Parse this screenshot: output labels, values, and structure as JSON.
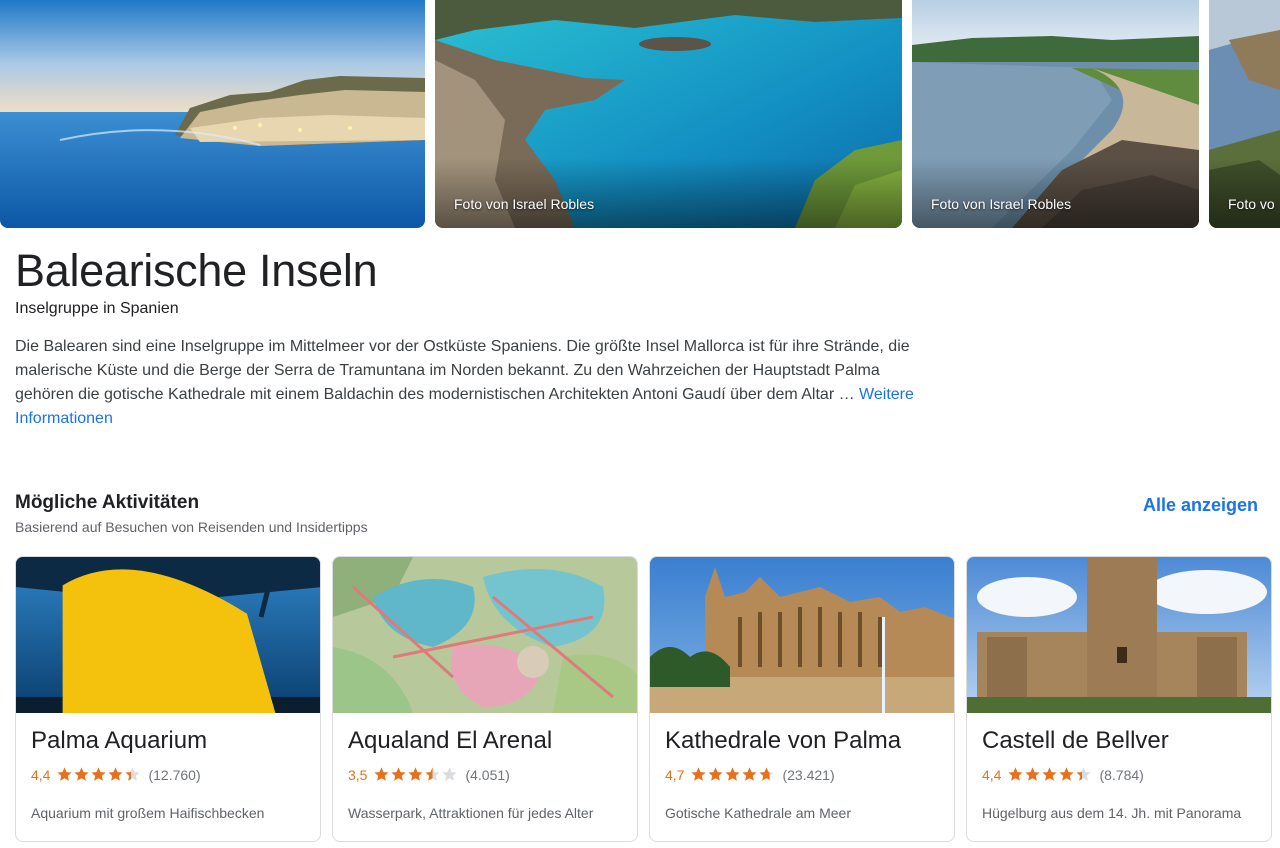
{
  "photos": [
    {
      "credit": ""
    },
    {
      "credit": "Foto von Israel Robles"
    },
    {
      "credit": "Foto von Israel Robles"
    },
    {
      "credit": "Foto vo"
    }
  ],
  "place": {
    "title": "Balearische Inseln",
    "subtitle": "Inselgruppe in Spanien",
    "description": "Die Balearen sind eine Inselgruppe im Mittelmeer vor der Ostküste Spaniens. Die größte Insel Mallorca ist für ihre Strände, die malerische Küste und die Berge der Serra de Tramuntana im Norden bekannt. Zu den Wahrzeichen der Hauptstadt Palma gehören die gotische Kathedrale mit einem Baldachin des modernistischen Architekten Antoni Gaudí über dem Altar … ",
    "more_link": "Weitere Informationen"
  },
  "activities": {
    "title": "Mögliche Aktivitäten",
    "subtitle": "Basierend auf Besuchen von Reisenden und Insidertipps",
    "show_all": "Alle anzeigen",
    "cards": [
      {
        "name": "Palma Aquarium",
        "rating": "4,4",
        "stars": 4.4,
        "reviews": "(12.760)",
        "description": "Aquarium mit großem Haifischbecken"
      },
      {
        "name": "Aqualand El Arenal",
        "rating": "3,5",
        "stars": 3.5,
        "reviews": "(4.051)",
        "description": "Wasserpark, Attraktionen für jedes Alter"
      },
      {
        "name": "Kathedrale von Palma",
        "rating": "4,7",
        "stars": 4.7,
        "reviews": "(23.421)",
        "description": "Gotische Kathedrale am Meer"
      },
      {
        "name": "Castell de Bellver",
        "rating": "4,4",
        "stars": 4.4,
        "reviews": "(8.784)",
        "description": "Hügelburg aus dem 14. Jh. mit Panorama"
      }
    ]
  },
  "colors": {
    "accent": "#1a73e8",
    "rating": "#e7711b",
    "star_empty": "#dadce0"
  }
}
